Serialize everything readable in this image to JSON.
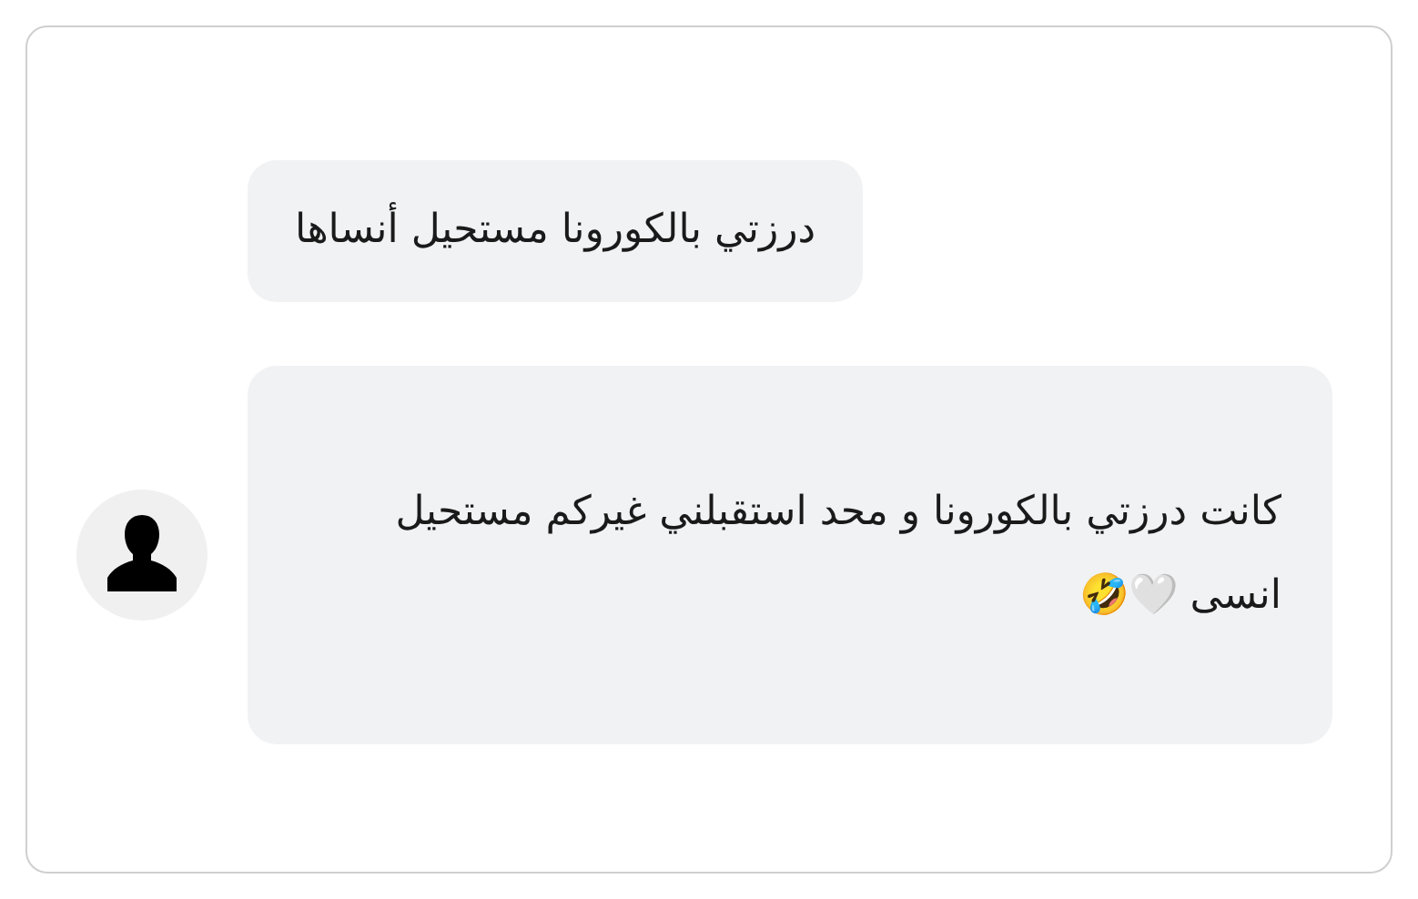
{
  "messages": [
    {
      "text": "درزتي بالكورونا مستحيل أنساها",
      "avatar": false
    },
    {
      "text": "كانت درزتي بالكورونا و محد استقبلني غيركم مستحيل انسى 🤍🤣",
      "avatar": true
    }
  ]
}
